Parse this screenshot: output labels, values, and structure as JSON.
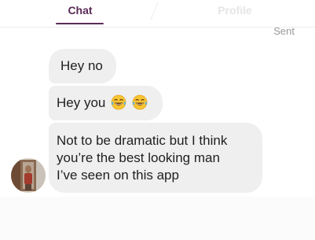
{
  "tabs": [
    {
      "label": "Chat",
      "active": true
    },
    {
      "label": "Profile",
      "active": false
    }
  ],
  "status": {
    "sent": "Sent"
  },
  "messages": [
    {
      "text": "Hey no"
    },
    {
      "text": "Hey you",
      "emoji": [
        "tears-of-joy-emoji",
        "tears-of-joy-emoji"
      ]
    },
    {
      "lines": [
        "Not to be dramatic but I think",
        "you’re the best looking man",
        "I’ve seen on this app"
      ]
    }
  ],
  "colors": {
    "accent": "#5b2a55",
    "bubble": "#efefef",
    "inactive_tab": "#e6e6e6",
    "status_text": "#9a9a9a"
  }
}
